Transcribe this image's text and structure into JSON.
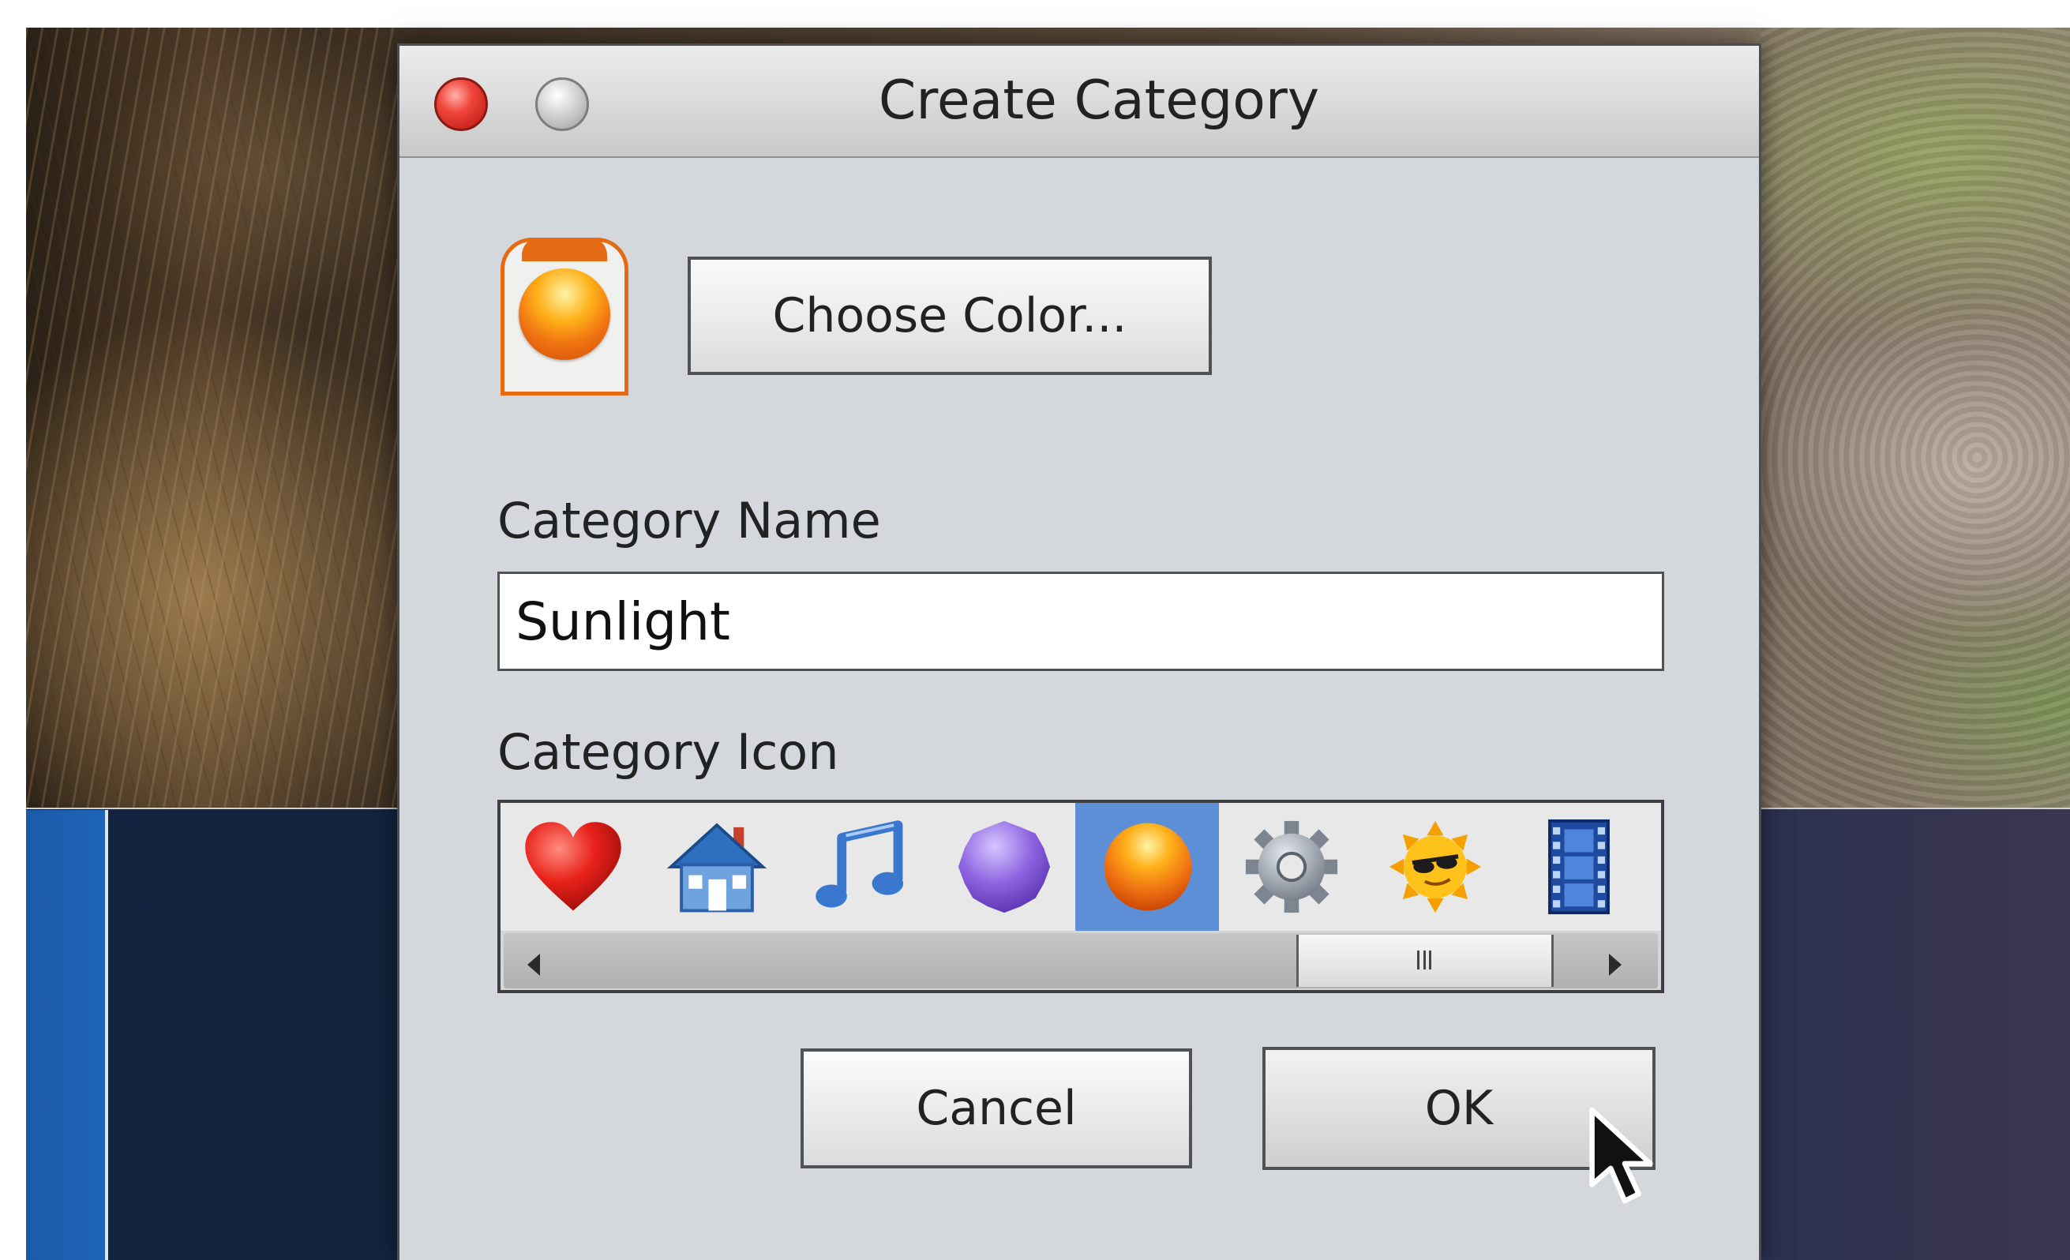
{
  "dialog": {
    "title": "Create Category",
    "choose_color_label": "Choose Color...",
    "name_label": "Category Name",
    "name_value": "Sunlight",
    "icon_label": "Category Icon",
    "cancel_label": "Cancel",
    "ok_label": "OK",
    "selected_color": "#f07412",
    "icons": [
      {
        "name": "heart-icon",
        "selected": false
      },
      {
        "name": "house-icon",
        "selected": false
      },
      {
        "name": "music-note-icon",
        "selected": false
      },
      {
        "name": "purple-circle-icon",
        "selected": false
      },
      {
        "name": "orange-ball-icon",
        "selected": true
      },
      {
        "name": "gear-icon",
        "selected": false
      },
      {
        "name": "sun-sunglasses-icon",
        "selected": false
      },
      {
        "name": "film-strip-icon",
        "selected": false
      }
    ]
  },
  "colors": {
    "close_button": "#f0453b",
    "selection_highlight": "#5c8fd6",
    "swatch_border": "#e46a14"
  }
}
